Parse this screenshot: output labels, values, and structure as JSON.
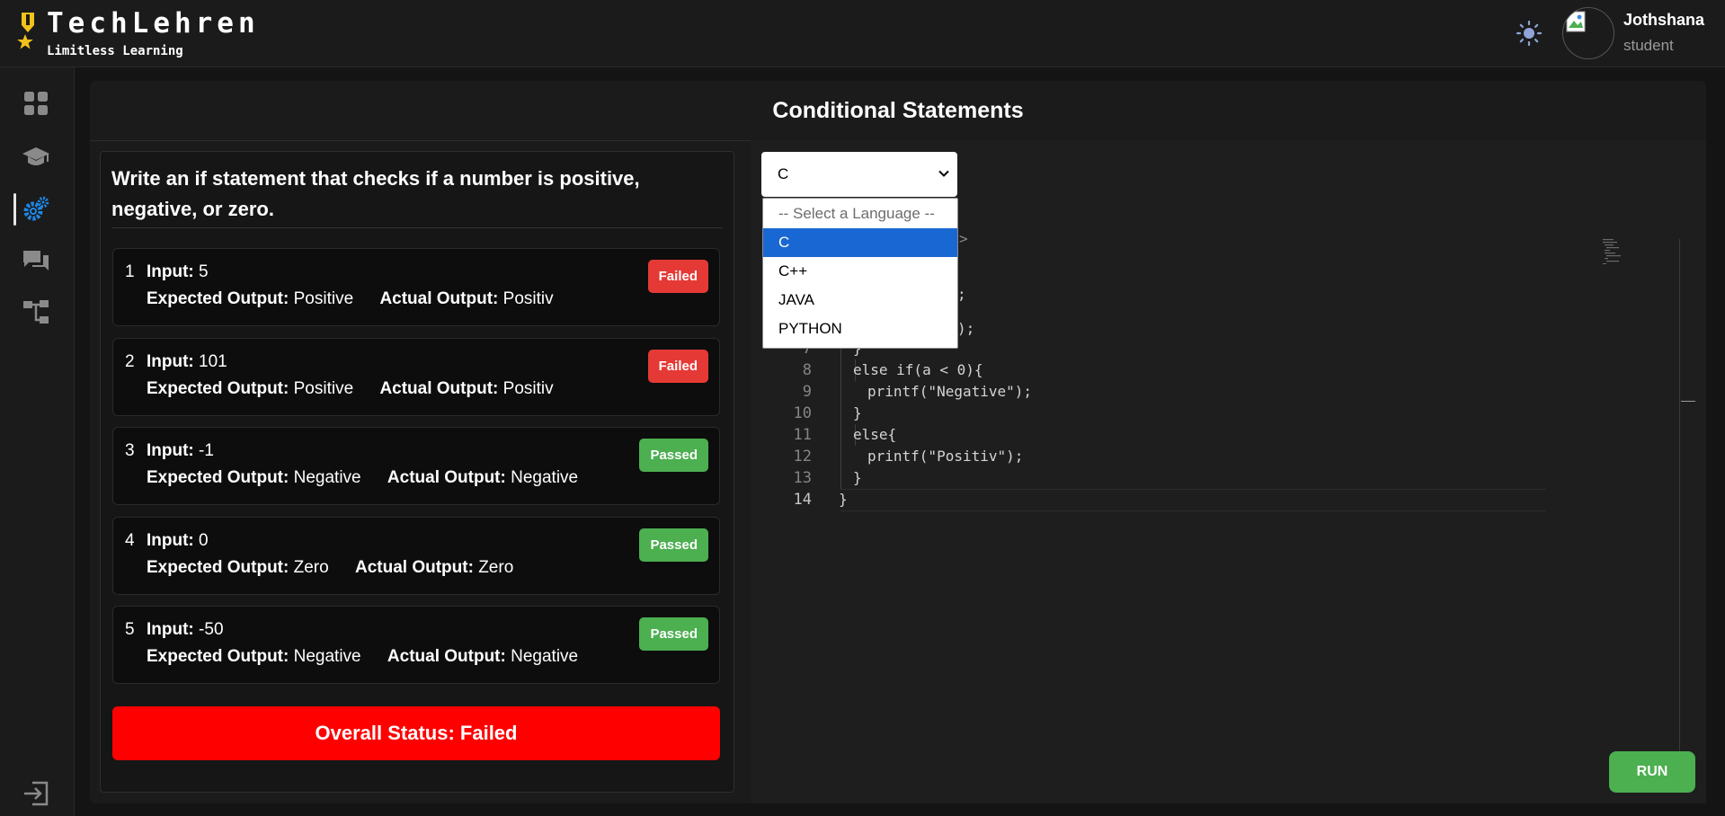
{
  "brand": {
    "name": "TechLehren",
    "tagline": "Limitless Learning"
  },
  "user": {
    "name": "Jothshana",
    "role": "student"
  },
  "colors": {
    "background": "#141414",
    "panel": "#1b1b1c",
    "failed": "#e53935",
    "passed": "#4caf50",
    "overall_failed": "#ff0000",
    "active_icon": "#1e88e5",
    "select_highlight": "#1967d2",
    "run_button": "#4caf50"
  },
  "sidebar": {
    "items": [
      {
        "icon": "dashboard-icon",
        "active": false
      },
      {
        "icon": "graduation-cap-icon",
        "active": false
      },
      {
        "icon": "gears-icon",
        "active": true
      },
      {
        "icon": "chat-icon",
        "active": false
      },
      {
        "icon": "flowchart-icon",
        "active": false
      }
    ],
    "logout_icon": "logout-icon"
  },
  "page": {
    "title": "Conditional Statements"
  },
  "question": "Write an if statement that checks if a number is positive, negative, or zero.",
  "labels": {
    "input": "Input:",
    "expected": "Expected Output:",
    "actual": "Actual Output:"
  },
  "test_cases": [
    {
      "num": "1",
      "input": "5",
      "expected": "Positive",
      "actual": "Positiv",
      "status": "Failed"
    },
    {
      "num": "2",
      "input": "101",
      "expected": "Positive",
      "actual": "Positiv",
      "status": "Failed"
    },
    {
      "num": "3",
      "input": "-1",
      "expected": "Negative",
      "actual": "Negative",
      "status": "Passed"
    },
    {
      "num": "4",
      "input": "0",
      "expected": "Zero",
      "actual": "Zero",
      "status": "Passed"
    },
    {
      "num": "5",
      "input": "-50",
      "expected": "Negative",
      "actual": "Negative",
      "status": "Passed"
    }
  ],
  "overall_status": "Overall Status: Failed",
  "language_select": {
    "value": "C",
    "options": [
      "-- Select a Language --",
      "C",
      "C++",
      "JAVA",
      "PYTHON"
    ],
    "selected_index": 1
  },
  "editor": {
    "visible_lines": [
      {
        "num": "7",
        "text": "}"
      },
      {
        "num": "8",
        "text": "else if(a < 0){"
      },
      {
        "num": "9",
        "text": "printf(\"Negative\");"
      },
      {
        "num": "10",
        "text": "}"
      },
      {
        "num": "11",
        "text": "else{"
      },
      {
        "num": "12",
        "text": "printf(\"Positiv\");"
      },
      {
        "num": "13",
        "text": "}"
      },
      {
        "num": "14",
        "text": "}"
      }
    ],
    "partial_fragments": [
      ">",
      ";",
      ");"
    ],
    "active_line": "14"
  },
  "run_label": "RUN"
}
